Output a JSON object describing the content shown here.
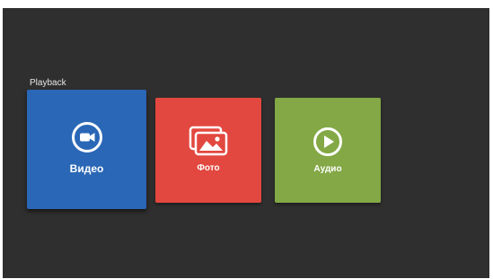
{
  "section": {
    "title": "Playback"
  },
  "tiles": [
    {
      "label": "Видео",
      "icon": "video-camera-icon",
      "color": "#2a67b6",
      "focused": true
    },
    {
      "label": "Фото",
      "icon": "photo-gallery-icon",
      "color": "#e2483f",
      "focused": false
    },
    {
      "label": "Аудио",
      "icon": "play-circle-icon",
      "color": "#83a845",
      "focused": false
    }
  ],
  "colors": {
    "background": "#2f2f2f",
    "text": "#ffffff"
  }
}
